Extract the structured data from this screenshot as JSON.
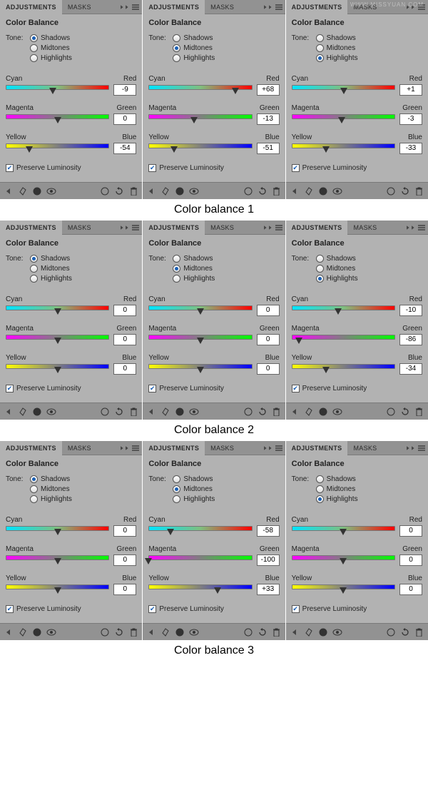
{
  "watermark": "WWW.MISSYUAN.COM",
  "tabs": {
    "adjustments": "ADJUSTMENTS",
    "masks": "MASKS"
  },
  "panel_title": "Color Balance",
  "tone_label": "Tone:",
  "tone_options": [
    "Shadows",
    "Midtones",
    "Highlights"
  ],
  "slider_labels": {
    "cr": {
      "left": "Cyan",
      "right": "Red"
    },
    "mg": {
      "left": "Magenta",
      "right": "Green"
    },
    "yb": {
      "left": "Yellow",
      "right": "Blue"
    }
  },
  "preserve_label": "Preserve Luminosity",
  "captions": [
    "Color balance 1",
    "Color balance 2",
    "Color balance 3"
  ],
  "groups": [
    {
      "panels": [
        {
          "tone_sel": 0,
          "values": {
            "cr": -9,
            "mg": 0,
            "yb": -54
          },
          "preserve": true
        },
        {
          "tone_sel": 1,
          "values": {
            "cr": 68,
            "mg": -13,
            "yb": -51
          },
          "preserve": true
        },
        {
          "tone_sel": 2,
          "values": {
            "cr": 1,
            "mg": -3,
            "yb": -33
          },
          "preserve": true
        }
      ]
    },
    {
      "panels": [
        {
          "tone_sel": 0,
          "values": {
            "cr": 0,
            "mg": 0,
            "yb": 0
          },
          "preserve": true
        },
        {
          "tone_sel": 1,
          "values": {
            "cr": 0,
            "mg": 0,
            "yb": 0
          },
          "preserve": true
        },
        {
          "tone_sel": 2,
          "values": {
            "cr": -10,
            "mg": -86,
            "yb": -34
          },
          "preserve": true
        }
      ]
    },
    {
      "panels": [
        {
          "tone_sel": 0,
          "values": {
            "cr": 0,
            "mg": 0,
            "yb": 0
          },
          "preserve": true
        },
        {
          "tone_sel": 1,
          "values": {
            "cr": -58,
            "mg": -100,
            "yb": 33
          },
          "preserve": true
        },
        {
          "tone_sel": 2,
          "values": {
            "cr": 0,
            "mg": 0,
            "yb": 0
          },
          "preserve": true
        }
      ]
    }
  ]
}
